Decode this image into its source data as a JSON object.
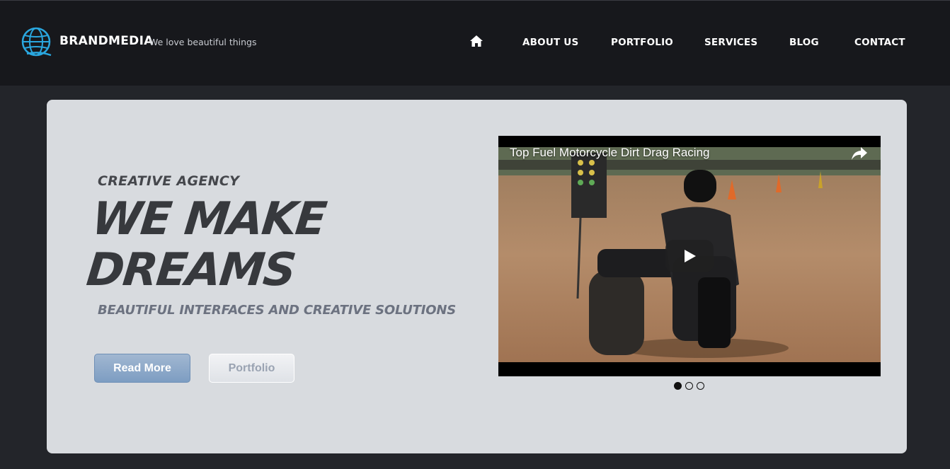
{
  "header": {
    "brand": "BRANDMEDIA",
    "tagline": "We love beautiful things",
    "logo_icon": "globe-icon",
    "nav": {
      "home_icon": "home-icon",
      "about": "ABOUT US",
      "portfolio": "PORTFOLIO",
      "services": "SERVICES",
      "blog": "BLOG",
      "contact": "CONTACT"
    }
  },
  "hero": {
    "kicker": "CREATIVE AGENCY",
    "headline": "WE MAKE DREAMS",
    "subline": "BEAUTIFUL INTERFACES AND CREATIVE SOLUTIONS",
    "primary_button": "Read More",
    "secondary_button": "Portfolio"
  },
  "video": {
    "title": "Top Fuel Motorcycle Dirt Drag Racing",
    "share_icon": "share-icon",
    "play_icon": "play-icon"
  },
  "slider": {
    "slide_count": 3,
    "active_index": 0
  },
  "colors": {
    "header_bg": "#17181c",
    "page_bg": "#23252a",
    "hero_bg": "#d8dbdf",
    "logo_accent": "#2aa7df",
    "primary_button": "#8aa8c9"
  }
}
